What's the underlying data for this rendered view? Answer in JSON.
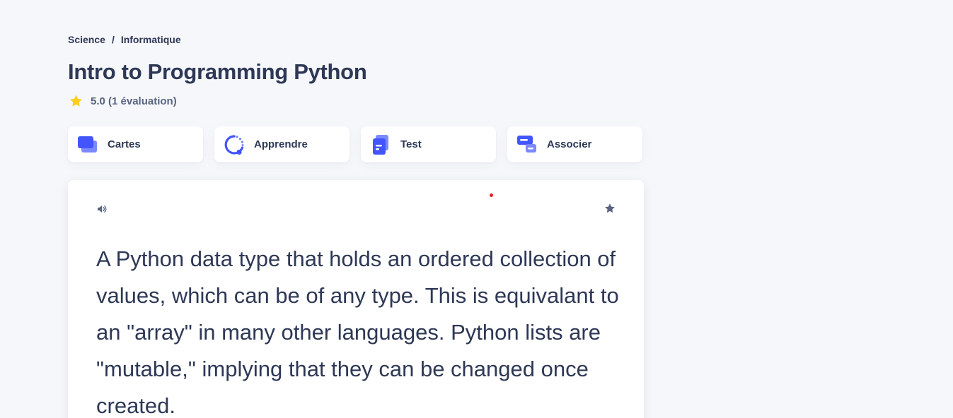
{
  "breadcrumb": {
    "items": [
      "Science",
      "Informatique"
    ],
    "separator": "/"
  },
  "title": "Intro to Programming Python",
  "rating": {
    "text": "5.0 (1 évaluation)",
    "icon": "star-icon",
    "star_color": "#ffcd1f"
  },
  "modes": [
    {
      "label": "Cartes",
      "icon": "flashcards-icon"
    },
    {
      "label": "Apprendre",
      "icon": "learn-icon"
    },
    {
      "label": "Test",
      "icon": "test-icon"
    },
    {
      "label": "Associer",
      "icon": "match-icon"
    }
  ],
  "card": {
    "term": "A Python data type that holds an ordered collection of values, which can be of any type. This is equivalant to an \"array\" in many other languages. Python lists are \"mutable,\" implying that they can be changed once created.",
    "audio_icon": "speaker-icon",
    "favorite_icon": "star-icon"
  },
  "colors": {
    "background": "#f6f7fb",
    "text": "#2e3856",
    "accent": "#4255ff",
    "star": "#ffcd1f"
  }
}
